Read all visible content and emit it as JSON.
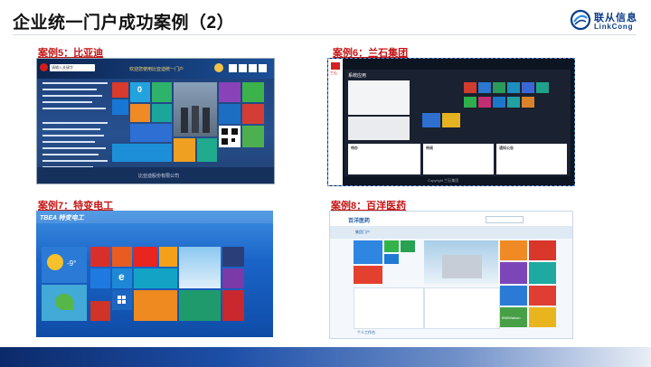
{
  "page": {
    "title": "企业统一门户成功案例（2）"
  },
  "brand": {
    "name_cn": "联从信息",
    "name_en": "LinkCong",
    "color": "#0b3b8c"
  },
  "cases": [
    {
      "label": "案例5：比亚迪"
    },
    {
      "label": "案例6：兰石集团"
    },
    {
      "label": "案例7：特变电工"
    },
    {
      "label": "案例8：百洋医药"
    }
  ],
  "byd": {
    "search_placeholder": "请输入关键字",
    "nav_text": "欢迎您使用比亚迪统一门户",
    "tile_number": "0",
    "footer_text": "比亚迪股份有限公司"
  },
  "lanshi": {
    "logo_text": "兰石",
    "app_title": "系统应用",
    "panel_titles": [
      "待办",
      "待阅",
      "通知公告"
    ],
    "footer_text": "Copyright 兰石集团"
  },
  "tbea": {
    "logo_text": "TBEA 特变电工",
    "temperature": "-9°",
    "ie_text": "e"
  },
  "baiyang": {
    "logo_text": "百洋医药",
    "home_label": "集团门户",
    "watson_text": "IBMWatson",
    "bottom_text": "个人工作台"
  },
  "colors": {
    "accent_red": "#c41414",
    "tbea_blue": "#1a64c8",
    "lanshi_dark": "#1a2130"
  }
}
